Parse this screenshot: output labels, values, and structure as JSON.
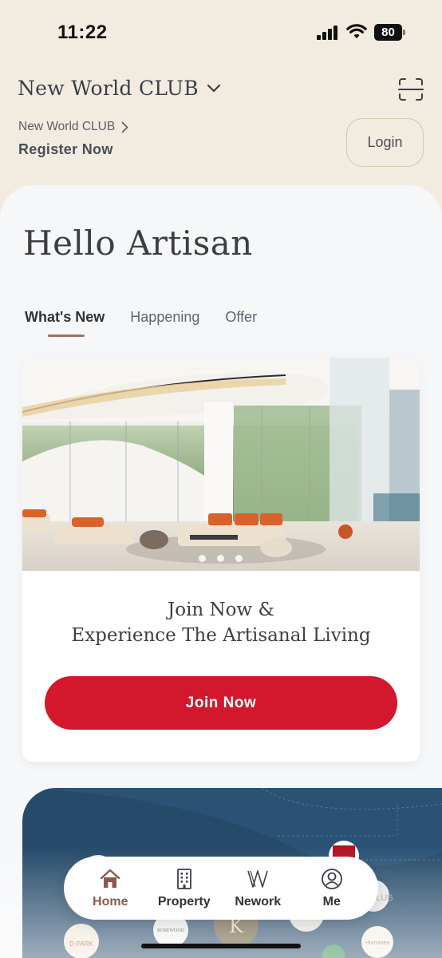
{
  "status_bar": {
    "time": "11:22",
    "battery": "80"
  },
  "header": {
    "brand_title": "New World CLUB",
    "club_link": "New World CLUB",
    "register_label": "Register Now",
    "login_label": "Login"
  },
  "greeting": "Hello Artisan",
  "tabs": [
    {
      "label": "What's New",
      "active": true
    },
    {
      "label": "Happening",
      "active": false
    },
    {
      "label": "Offer",
      "active": false
    }
  ],
  "promo": {
    "title_line1": "Join Now &",
    "title_line2": "Experience The Artisanal Living",
    "button_label": "Join Now",
    "carousel_count": 3,
    "carousel_active": 1
  },
  "network_logos": {
    "d_park": "D·PARK",
    "rosewood": "ROSEWOOD",
    "k_logo": "K",
    "club": "CLUB",
    "humanea": "Humanea"
  },
  "bottom_nav": [
    {
      "label": "Home",
      "icon": "home-icon",
      "active": true
    },
    {
      "label": "Property",
      "icon": "building-icon",
      "active": false
    },
    {
      "label": "Nework",
      "icon": "network-icon",
      "active": false
    },
    {
      "label": "Me",
      "icon": "profile-icon",
      "active": false
    }
  ],
  "colors": {
    "header_bg": "#f2ebdf",
    "accent_red": "#d3172d",
    "tab_underline": "#9d7468",
    "network_bg": "#254a6a",
    "nav_active": "#8a5a4e"
  }
}
